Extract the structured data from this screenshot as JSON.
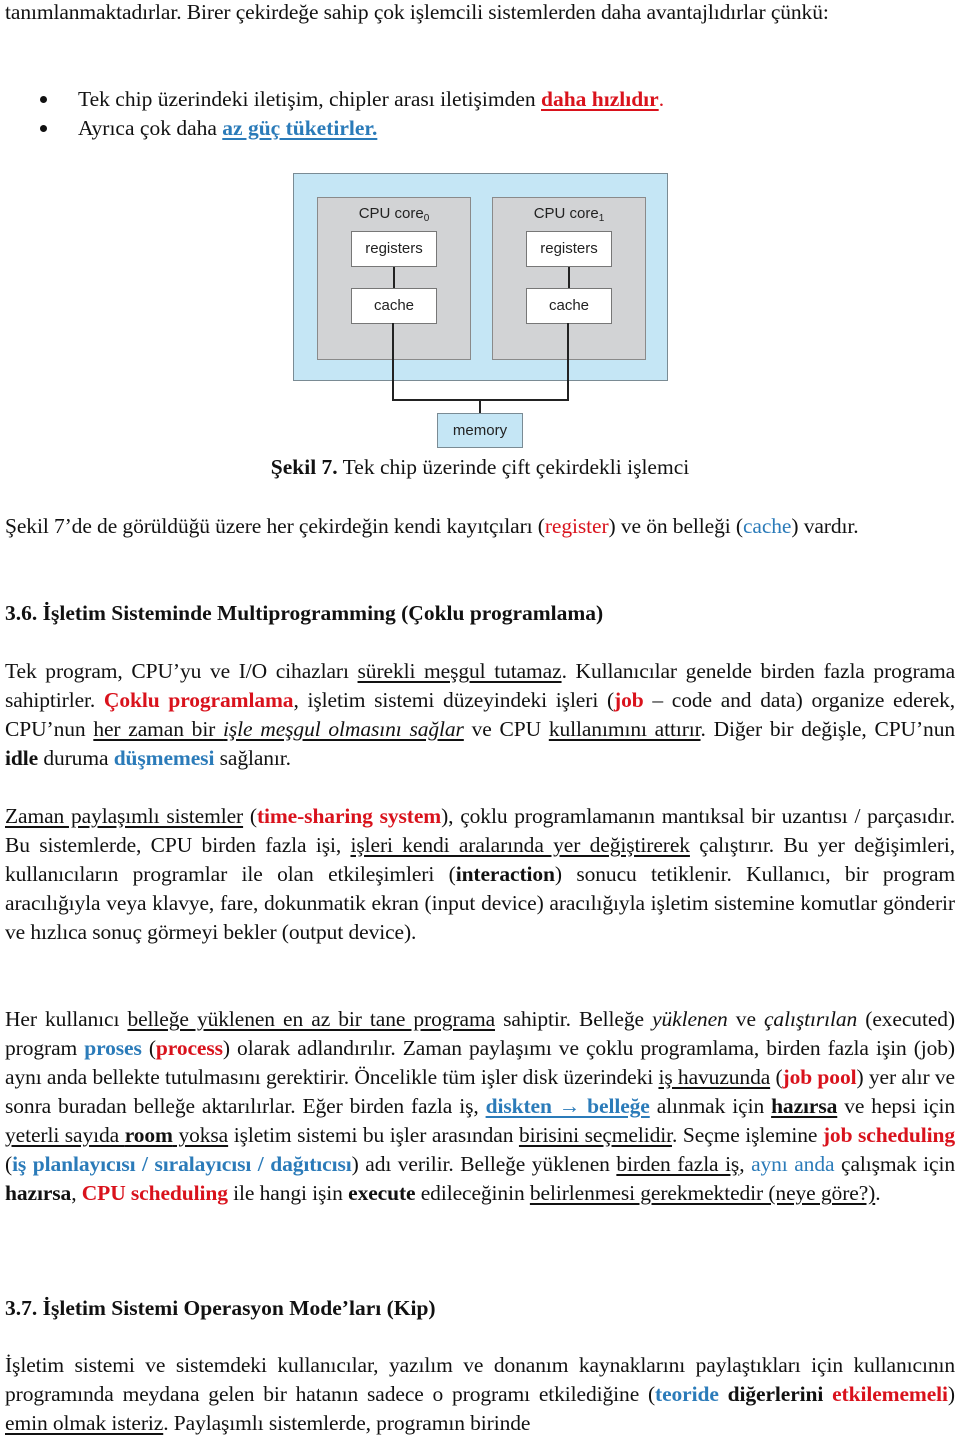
{
  "intro": {
    "line": "tanımlanmaktadırlar. Birer çekirdeğe sahip çok işlemcili sistemlerden daha avantajlıdırlar çünkü:"
  },
  "bullets": [
    {
      "text": "Tek chip üzerindeki iletişim, chipler arası iletişimden ",
      "highlight": "daha hızlıdır",
      "tail": "."
    },
    {
      "text": "Ayrıca çok daha ",
      "highlight": "az güç tüketirler."
    }
  ],
  "figure": {
    "cores": [
      {
        "title": "CPU core",
        "subscript": "0",
        "registers": "registers",
        "cache": "cache"
      },
      {
        "title": "CPU core",
        "subscript": "1",
        "registers": "registers",
        "cache": "cache"
      }
    ],
    "memory": "memory",
    "caption_label": "Şekil 7.",
    "caption_text": " Tek chip üzerinde çift çekirdekli işlemci"
  },
  "para_fig": {
    "a": "Şekil 7’de de görüldüğü üzere her çekirdeğin kendi kayıtçıları (",
    "register": "register",
    "b": ") ve ön belleği (",
    "cache": "cache",
    "c": ") vardır."
  },
  "section36": {
    "heading": "3.6. İşletim Sisteminde Multiprogramming (Çoklu programlama)",
    "p1": {
      "a": "Tek program, CPU’yu ve I/O cihazları ",
      "u1": "sürekli meşgul tutamaz",
      "b": ". Kullanıcılar genelde birden fazla programa sahiptirler. ",
      "red1": "Çoklu programlama",
      "c": ", işletim sistemi düzeyindeki işleri (",
      "red2": "job",
      "d": " – code and data) organize ederek, CPU’nun ",
      "u2a": "her zaman bir ",
      "u2i": "işle meşgul olmasını sağlar",
      "e": " ve CPU ",
      "u3": "kullanımını attırır",
      "f": ". Diğer bir değişle, CPU’nun ",
      "bold1": "idle",
      "g": " duruma ",
      "blue1": "düşmemesi",
      "h": " sağlanır."
    },
    "p2": {
      "u1": "Zaman paylaşımlı sistemler",
      "a": " (",
      "red1": "time-sharing system",
      "b": "), çoklu programlamanın mantıksal bir uzantısı / parçasıdır. Bu sistemlerde, CPU birden fazla işi, ",
      "u2": "işleri kendi aralarında yer değiştirerek",
      "c": " çalıştırır. Bu yer değişimleri, kullanıcıların programlar ile olan etkileşimleri (",
      "bold1": "interaction",
      "d": ") sonucu tetiklenir. Kullanıcı, bir program aracılığıyla veya klavye, fare, dokunmatik ekran (input device) aracılığıyla işletim sistemine komutlar gönderir ve hızlıca sonuç görmeyi bekler (output device)."
    },
    "p3": {
      "a": "Her kullanıcı ",
      "u1": "belleğe yüklenen en az bir tane programa",
      "b": " sahiptir. Belleğe ",
      "i1": "yüklenen",
      "c": " ve ",
      "i2": "çalıştırılan",
      "d": " (executed) program ",
      "blue1": "proses",
      "e": " (",
      "red1": "process",
      "f": ") olarak adlandırılır. Zaman paylaşımı ve çoklu programlama, birden fazla işin (job) aynı anda bellekte tutulmasını gerektirir. Öncelikle tüm işler disk üzerindeki ",
      "u2": "iş havuzunda",
      "g": " (",
      "red2": "job pool",
      "h": ") yer alır ve sonra buradan belleğe aktarılırlar. Eğer birden fazla iş, ",
      "blue2": "diskten → belleğe",
      "i": " alınmak için ",
      "bold1": "hazırsa",
      "j": " ve hepsi için ",
      "u3a": "yeterli sayıda ",
      "u3b": "room",
      "u3c": " yoksa",
      "k": " işletim sistemi bu işler arasından ",
      "u4": "birisini seçmelidir",
      "l": ". Seçme işlemine ",
      "red3": "job scheduling",
      "m": " (",
      "blue3": "iş planlayıcısı / sıralayıcısı / dağıtıcısı",
      "n": ") adı verilir. Belleğe yüklenen ",
      "u5": "birden fazla iş",
      "o": ", ",
      "blue4": "aynı anda",
      "p": " çalışmak için ",
      "bold2": "hazırsa",
      "q": ", ",
      "red4": "CPU scheduling",
      "r": " ile hangi işin ",
      "bold3": "execute",
      "s": " edileceğinin ",
      "u6": "belirlenmesi gerekmektedir (neye göre?)",
      "t": "."
    }
  },
  "section37": {
    "heading": "3.7. İşletim Sistemi Operasyon Mode’ları (Kip)",
    "p1": {
      "a": "İşletim sistemi ve sistemdeki kullanıcılar, yazılım ve donanım kaynaklarını paylaştıkları için kullanıcının programında meydana gelen bir hatanın sadece o programı etkilediğine (",
      "blue1": "teoride",
      "b": " ",
      "bold1": "diğerlerini",
      "c": " ",
      "red1": "etkilememeli",
      "d": ") ",
      "u1": "emin olmak isteriz",
      "e": ". Paylaşımlı sistemlerde, programın birinde"
    }
  },
  "colors": {
    "red": "#d9121c",
    "blue": "#2b7bb9",
    "chip_fill": "#c5e6f5",
    "core_fill": "#d2d3d5"
  }
}
